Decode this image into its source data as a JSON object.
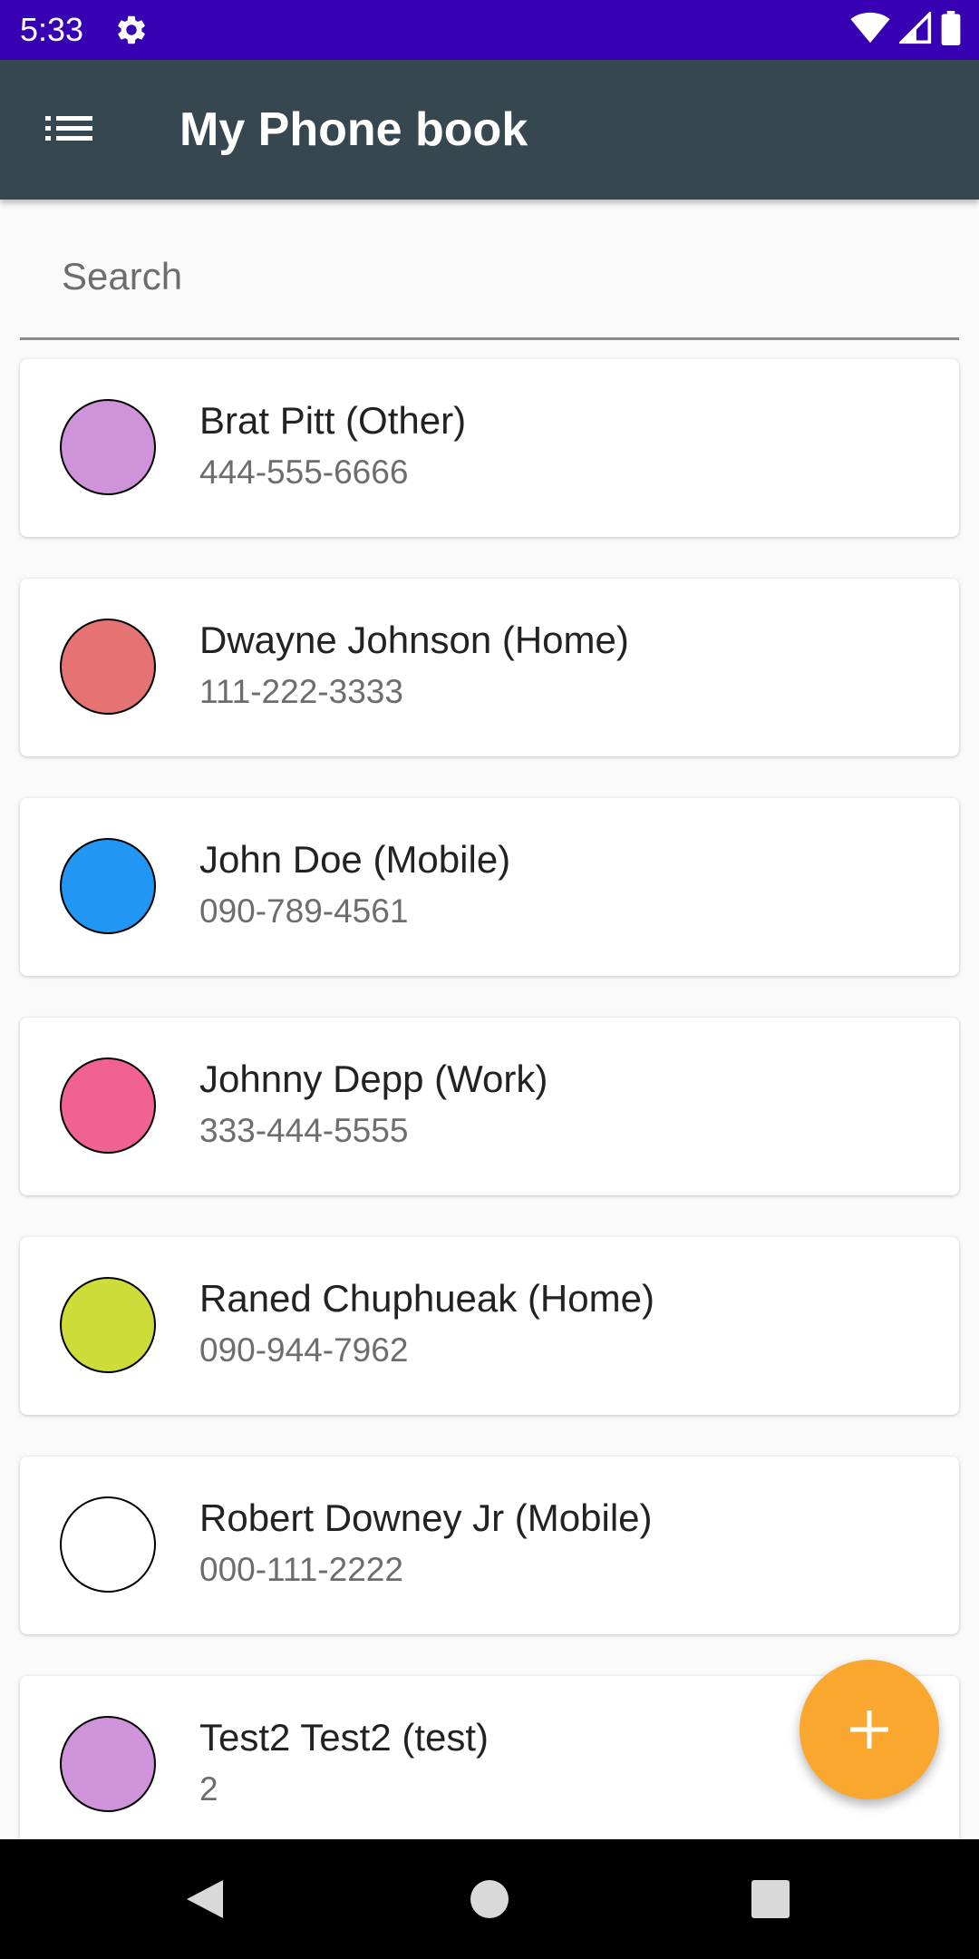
{
  "status_bar": {
    "time": "5:33",
    "icons": [
      "gear-icon",
      "wifi-icon",
      "signal-icon",
      "battery-icon"
    ],
    "background": "#3700b3"
  },
  "app_bar": {
    "title": "My Phone book",
    "menu_icon": "list-menu-icon",
    "background": "#37474f"
  },
  "search": {
    "placeholder": "Search",
    "value": ""
  },
  "contacts": [
    {
      "name": "Brat Pitt (Other)",
      "phone": "444-555-6666",
      "color": "#ce93d8"
    },
    {
      "name": "Dwayne Johnson (Home)",
      "phone": "111-222-3333",
      "color": "#e57373"
    },
    {
      "name": "John Doe (Mobile)",
      "phone": "090-789-4561",
      "color": "#2196f3"
    },
    {
      "name": "Johnny Depp (Work)",
      "phone": "333-444-5555",
      "color": "#f06292"
    },
    {
      "name": "Raned Chuphueak (Home)",
      "phone": "090-944-7962",
      "color": "#cddc39"
    },
    {
      "name": "Robert Downey Jr (Mobile)",
      "phone": "000-111-2222",
      "color": "#ffffff"
    },
    {
      "name": "Test2 Test2 (test)",
      "phone": "2",
      "color": "#ce93d8"
    }
  ],
  "fab": {
    "icon": "plus-icon",
    "color": "#f9a72f"
  },
  "nav_bar": {
    "icons": [
      "back-icon",
      "home-icon",
      "recents-icon"
    ]
  }
}
